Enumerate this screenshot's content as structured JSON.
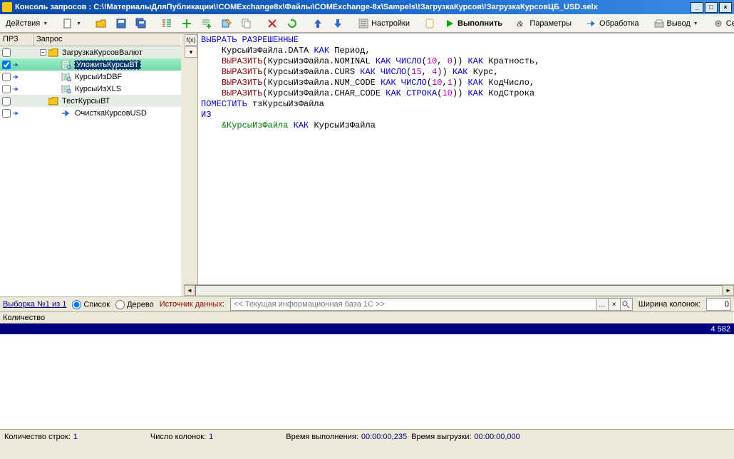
{
  "window": {
    "title": "Консоль запросов : C:\\!МатериалыДляПубликации\\!COMExchange8x\\Файлы\\COMExchange-8x\\Sampels\\!ЗагрузкаКурсов\\!ЗагрузкаКурсовЦБ_USD.selx"
  },
  "toolbar": {
    "actions": "Действия",
    "settings": "Настройки",
    "execute": "Выполнить",
    "params": "Параметры",
    "process": "Обработка",
    "output": "Вывод",
    "service": "Сервис"
  },
  "leftpane": {
    "col1": "ПРЗ",
    "col2": "Запрос",
    "items": [
      {
        "level": 0,
        "exp": "-",
        "check": false,
        "folder": true,
        "label": "ЗагрузкаКурсовВалют",
        "icon": "folder"
      },
      {
        "level": 1,
        "exp": "none",
        "check": true,
        "folder": false,
        "label": "УложитьКурсыВТ",
        "icon": "sheet",
        "sel": true
      },
      {
        "level": 1,
        "exp": "none",
        "check": false,
        "folder": false,
        "label": "КурсыИзDBF",
        "icon": "sheet"
      },
      {
        "level": 1,
        "exp": "none",
        "check": false,
        "folder": false,
        "label": "КурсыИзXLS",
        "icon": "sheet"
      },
      {
        "level": 0,
        "exp": "none",
        "check": false,
        "folder": true,
        "label": "ТестКурсыВТ",
        "icon": "folder-plain"
      },
      {
        "level": 1,
        "exp": "none",
        "check": false,
        "folder": false,
        "label": "ОчисткаКурсовUSD",
        "icon": "arrow"
      }
    ]
  },
  "editor": {
    "tokens": [
      [
        {
          "t": "ВЫБРАТЬ РАЗРЕШЕННЫЕ",
          "c": "kw"
        }
      ],
      [
        {
          "t": "    КурсыИзФайла.DATA ",
          "c": ""
        },
        {
          "t": "КАК",
          "c": "kw"
        },
        {
          "t": " Период,",
          "c": ""
        }
      ],
      [
        {
          "t": "    ",
          "c": ""
        },
        {
          "t": "ВЫРАЗИТЬ",
          "c": "func"
        },
        {
          "t": "(КурсыИзФайла.NOMINAL ",
          "c": ""
        },
        {
          "t": "КАК ЧИСЛО",
          "c": "kw"
        },
        {
          "t": "(",
          "c": ""
        },
        {
          "t": "10",
          "c": "num"
        },
        {
          "t": ", ",
          "c": ""
        },
        {
          "t": "0",
          "c": "num"
        },
        {
          "t": ")) ",
          "c": ""
        },
        {
          "t": "КАК",
          "c": "kw"
        },
        {
          "t": " Кратность,",
          "c": ""
        }
      ],
      [
        {
          "t": "    ",
          "c": ""
        },
        {
          "t": "ВЫРАЗИТЬ",
          "c": "func"
        },
        {
          "t": "(КурсыИзФайла.CURS ",
          "c": ""
        },
        {
          "t": "КАК ЧИСЛО",
          "c": "kw"
        },
        {
          "t": "(",
          "c": ""
        },
        {
          "t": "15",
          "c": "num"
        },
        {
          "t": ", ",
          "c": ""
        },
        {
          "t": "4",
          "c": "num"
        },
        {
          "t": ")) ",
          "c": ""
        },
        {
          "t": "КАК",
          "c": "kw"
        },
        {
          "t": " Курс,",
          "c": ""
        }
      ],
      [
        {
          "t": "    ",
          "c": ""
        },
        {
          "t": "ВЫРАЗИТЬ",
          "c": "func"
        },
        {
          "t": "(КурсыИзФайла.NUM_CODE ",
          "c": ""
        },
        {
          "t": "КАК ЧИСЛО",
          "c": "kw"
        },
        {
          "t": "(",
          "c": ""
        },
        {
          "t": "10",
          "c": "num"
        },
        {
          "t": ",",
          "c": ""
        },
        {
          "t": "1",
          "c": "num"
        },
        {
          "t": ")) ",
          "c": ""
        },
        {
          "t": "КАК",
          "c": "kw"
        },
        {
          "t": " КодЧисло,",
          "c": ""
        }
      ],
      [
        {
          "t": "    ",
          "c": ""
        },
        {
          "t": "ВЫРАЗИТЬ",
          "c": "func"
        },
        {
          "t": "(КурсыИзФайла.CHAR_CODE ",
          "c": ""
        },
        {
          "t": "КАК СТРОКА",
          "c": "kw"
        },
        {
          "t": "(",
          "c": ""
        },
        {
          "t": "10",
          "c": "num"
        },
        {
          "t": ")) ",
          "c": ""
        },
        {
          "t": "КАК",
          "c": "kw"
        },
        {
          "t": " КодСтрока",
          "c": ""
        }
      ],
      [
        {
          "t": "ПОМЕСТИТЬ",
          "c": "kw"
        },
        {
          "t": " тзКурсыИзФайла",
          "c": ""
        }
      ],
      [
        {
          "t": "ИЗ",
          "c": "kw"
        }
      ],
      [
        {
          "t": "    ",
          "c": ""
        },
        {
          "t": "&КурсыИзФайла",
          "c": "par"
        },
        {
          "t": " ",
          "c": ""
        },
        {
          "t": "КАК",
          "c": "kw"
        },
        {
          "t": " КурсыИзФайла",
          "c": ""
        }
      ]
    ]
  },
  "filter": {
    "selection": "Выборка №1 из 1",
    "list": "Список",
    "tree": "Дерево",
    "source": "Источник данных:",
    "source_val": "<< Текущая информационная база 1С >>",
    "colwidth_label": "Ширина колонок:",
    "colwidth_val": "0"
  },
  "grid": {
    "header": "Количество",
    "row_val": "4 582"
  },
  "status": {
    "rows_label": "Количество строк:",
    "rows": "1",
    "cols_label": "Число колонок:",
    "cols": "1",
    "exec_label": "Время выполнения:",
    "exec": "00:00:00,235",
    "dump_label": "Время выгрузки:",
    "dump": "00:00:00,000"
  }
}
